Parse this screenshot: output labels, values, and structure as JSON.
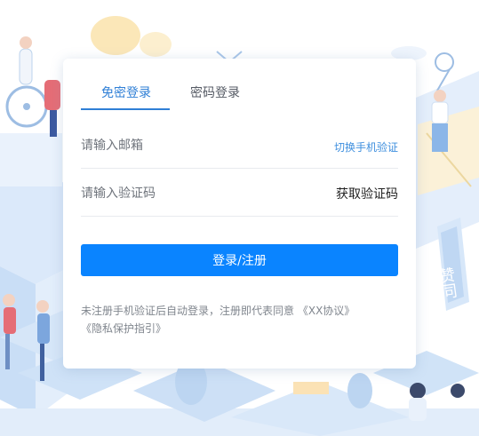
{
  "tabs": [
    {
      "label": "免密登录",
      "active": true
    },
    {
      "label": "密码登录",
      "active": false
    }
  ],
  "email_field": {
    "placeholder": "请输入邮箱",
    "value": ""
  },
  "switch_link": "切换手机验证",
  "code_field": {
    "placeholder": "请输入验证码",
    "value": ""
  },
  "get_code_label": "获取验证码",
  "submit_label": "登录/注册",
  "notice": {
    "prefix": "未注册手机验证后自动登录，注册即代表同意",
    "agreement": "《XX协议》",
    "privacy": "《隐私保护指引》"
  },
  "background": {
    "sign_text": "赞同"
  },
  "colors": {
    "accent": "#2f7fd6",
    "button": "#0a84ff",
    "link": "#3f8fde"
  }
}
